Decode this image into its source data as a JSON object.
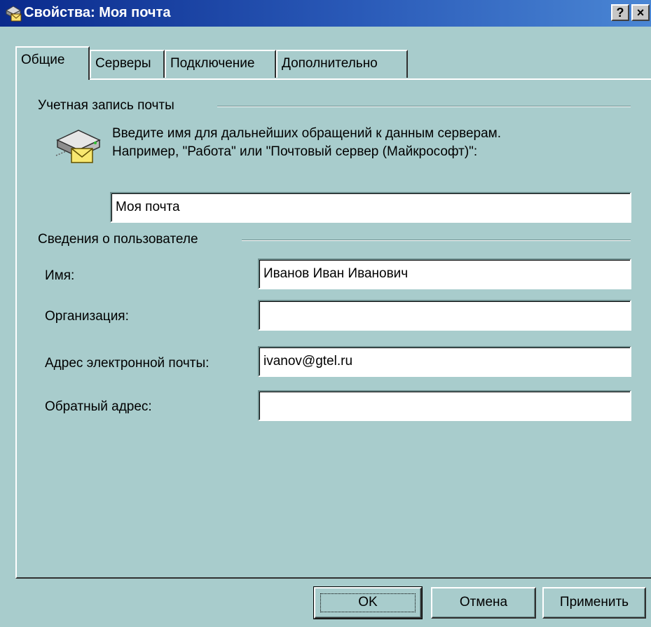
{
  "window": {
    "title": "Свойства: Моя почта",
    "help_button": "?",
    "close_button": "×",
    "icon": "mail-properties-icon"
  },
  "tabs": [
    {
      "label": "Общие",
      "active": true
    },
    {
      "label": "Серверы",
      "active": false
    },
    {
      "label": "Подключение",
      "active": false
    },
    {
      "label": "Дополнительно",
      "active": false
    }
  ],
  "account": {
    "group_label": "Учетная запись почты",
    "description_line1": "Введите имя для дальнейших обращений к данным серверам.",
    "description_line2": "Например, \"Работа\" или \"Почтовый сервер (Майкрософт)\":",
    "name_value": "Моя почта",
    "icon": "mail-server-icon"
  },
  "user": {
    "group_label": "Сведения о пользователе",
    "name_label": "Имя:",
    "name_value": "Иванов Иван Иванович",
    "org_label": "Организация:",
    "org_value": "",
    "email_label": "Адрес электронной почты:",
    "email_value": "ivanov@gtel.ru",
    "reply_label": "Обратный адрес:",
    "reply_value": ""
  },
  "buttons": {
    "ok": "OK",
    "cancel": "Отмена",
    "apply": "Применить"
  },
  "colors": {
    "dialog_background": "#a8cccc",
    "titlebar_start": "#0a2a8c",
    "titlebar_end": "#4a86d4"
  }
}
